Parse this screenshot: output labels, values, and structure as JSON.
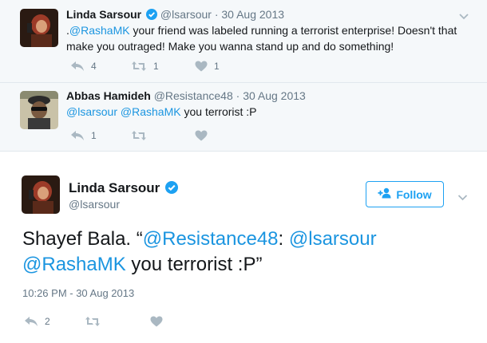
{
  "tweets": [
    {
      "name": "Linda Sarsour",
      "handle": "@lsarsour",
      "date": "· 30 Aug 2013",
      "text_prefix": ".",
      "text_mention": "@RashaMK",
      "text_rest": " your friend was labeled running a terrorist enterprise! Doesn't that make you outraged! Make you wanna stand up and do something!",
      "reply_count": "4",
      "retweet_count": "1",
      "like_count": "1"
    },
    {
      "name": "Abbas Hamideh",
      "handle": "@Resistance48",
      "date": "· 30 Aug 2013",
      "mention1": "@lsarsour",
      "mention2": "@RashaMK",
      "text_rest": " you terrorist :P",
      "reply_count": "1"
    }
  ],
  "main_tweet": {
    "name": "Linda Sarsour",
    "handle": "@lsarsour",
    "follow_label": "Follow",
    "text_start": "Shayef Bala. “",
    "mention1": "@Resistance48",
    "colon": ": ",
    "mention2": "@lsarsour",
    "mention3": "@RashaMK",
    "text_end": " you terrorist :P”",
    "timestamp": "10:26 PM - 30 Aug 2013",
    "reply_count": "2"
  },
  "icons": [
    "reply-icon",
    "retweet-icon",
    "like-icon",
    "verified-icon",
    "chevron-down-icon",
    "follow-person-icon"
  ],
  "colors": {
    "link": "#1b95e0",
    "accent": "#1da1f2",
    "muted": "#657786",
    "icon": "#aab8c2",
    "reply_background": "#f5f8fa"
  }
}
